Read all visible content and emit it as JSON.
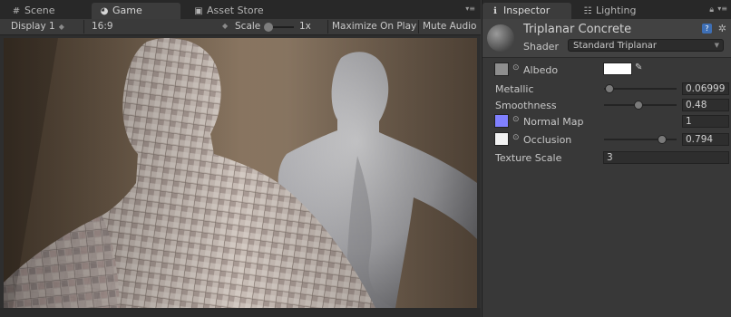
{
  "game_panel": {
    "tabs": [
      {
        "label": "Scene",
        "icon": "grid-icon"
      },
      {
        "label": "Game",
        "icon": "pacman-icon"
      },
      {
        "label": "Asset Store",
        "icon": "store-icon"
      }
    ],
    "toolbar": {
      "display": "Display 1",
      "aspect": "16:9",
      "scale_label": "Scale",
      "scale_value": "1x",
      "maximize": "Maximize On Play",
      "mute": "Mute Audio"
    }
  },
  "inspector": {
    "tabs": [
      {
        "label": "Inspector",
        "icon": "info-icon"
      },
      {
        "label": "Lighting",
        "icon": "lighting-icon"
      }
    ],
    "material_name": "Triplanar Concrete",
    "shader_label": "Shader",
    "shader_value": "Standard Triplanar",
    "properties": {
      "albedo_label": "Albedo",
      "albedo_color": "#ffffff",
      "metallic_label": "Metallic",
      "metallic_value": "0.06999",
      "metallic_level": 0.07,
      "smoothness_label": "Smoothness",
      "smoothness_value": "0.48",
      "smoothness_level": 0.48,
      "normal_label": "Normal Map",
      "normal_value": "1",
      "normal_color": "#8080ff",
      "occlusion_label": "Occlusion",
      "occlusion_value": "0.794",
      "occlusion_level": 0.794,
      "texture_scale_label": "Texture Scale",
      "texture_scale_value": "3"
    }
  }
}
